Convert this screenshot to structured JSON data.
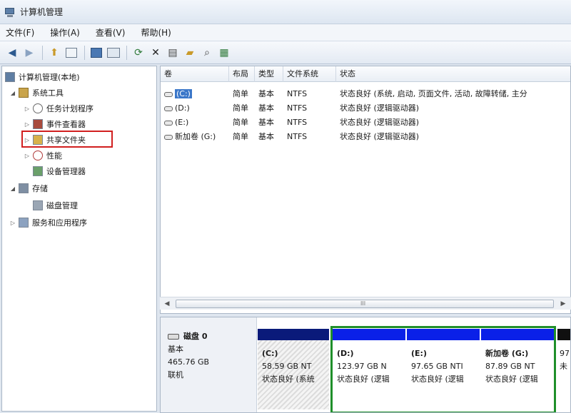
{
  "window": {
    "title": "计算机管理"
  },
  "menu": [
    "文件(F)",
    "操作(A)",
    "查看(V)",
    "帮助(H)"
  ],
  "toolbar": {
    "icons": [
      "back-arrow-icon",
      "forward-arrow-icon",
      "up-folder-icon",
      "console-tree-icon",
      "help-icon",
      "pane-icon",
      "refresh-icon",
      "delete-icon",
      "properties-icon",
      "open-folder-icon",
      "search-icon",
      "zoom-icon"
    ]
  },
  "tree": {
    "root": "计算机管理(本地)",
    "system_tools": "系统工具",
    "task_scheduler": "任务计划程序",
    "event_viewer": "事件查看器",
    "shared_folders": "共享文件夹",
    "performance": "性能",
    "device_manager": "设备管理器",
    "storage": "存储",
    "disk_management": "磁盘管理",
    "services_apps": "服务和应用程序"
  },
  "list": {
    "columns": [
      "卷",
      "布局",
      "类型",
      "文件系统",
      "状态"
    ],
    "rows": [
      {
        "volume": "(C:)",
        "layout": "简单",
        "type": "基本",
        "fs": "NTFS",
        "status": "状态良好 (系统, 启动, 页面文件, 活动, 故障转储, 主分"
      },
      {
        "volume": "(D:)",
        "layout": "简单",
        "type": "基本",
        "fs": "NTFS",
        "status": "状态良好 (逻辑驱动器)"
      },
      {
        "volume": "(E:)",
        "layout": "简单",
        "type": "基本",
        "fs": "NTFS",
        "status": "状态良好 (逻辑驱动器)"
      },
      {
        "volume": "新加卷 (G:)",
        "layout": "简单",
        "type": "基本",
        "fs": "NTFS",
        "status": "状态良好 (逻辑驱动器)"
      }
    ],
    "scroll_grip": "III"
  },
  "disk": {
    "name": "磁盘 0",
    "type": "基本",
    "size": "465.76 GB",
    "status": "联机",
    "partitions": [
      {
        "label": "(C:)",
        "size": "58.59 GB NT",
        "status": "状态良好 (系统"
      },
      {
        "label": "(D:)",
        "size": "123.97 GB N",
        "status": "状态良好 (逻辑"
      },
      {
        "label": "(E:)",
        "size": "97.65 GB NTI",
        "status": "状态良好 (逻辑"
      },
      {
        "label": "新加卷 (G:)",
        "size": "87.89 GB NT",
        "status": "状态良好 (逻辑"
      },
      {
        "label": "",
        "size": "97",
        "status": "未"
      }
    ]
  },
  "colors": {
    "primary_bar": "#0a1a7a",
    "logical_bar": "#0a20e8",
    "unallocated_bar": "#101010",
    "selection_frame": "#1f8f2a",
    "highlight_box": "#d11f1f"
  }
}
